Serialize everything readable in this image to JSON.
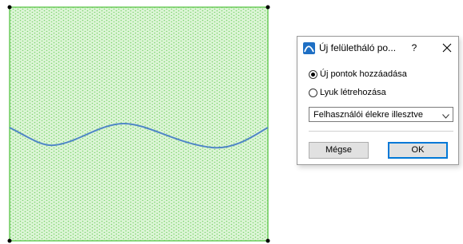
{
  "dialog": {
    "title": "Új felületháló po...",
    "help_label": "?",
    "close_icon": "close-icon",
    "app_icon": "app-logo-icon",
    "options": [
      {
        "label": "Új pontok hozzáadása",
        "checked": true
      },
      {
        "label": "Lyuk létrehozása",
        "checked": false
      }
    ],
    "dropdown": {
      "selected": "Felhasználói élekre illesztve",
      "icon": "chevron-down-icon"
    },
    "buttons": {
      "cancel": "Mégse",
      "ok": "OK"
    }
  },
  "colors": {
    "mesh_fill": "#dcf5d6",
    "mesh_border": "#6bcb5a",
    "mesh_dots": "#7ed36f",
    "edge_curve": "#4f86c6",
    "accent": "#0078d7"
  }
}
